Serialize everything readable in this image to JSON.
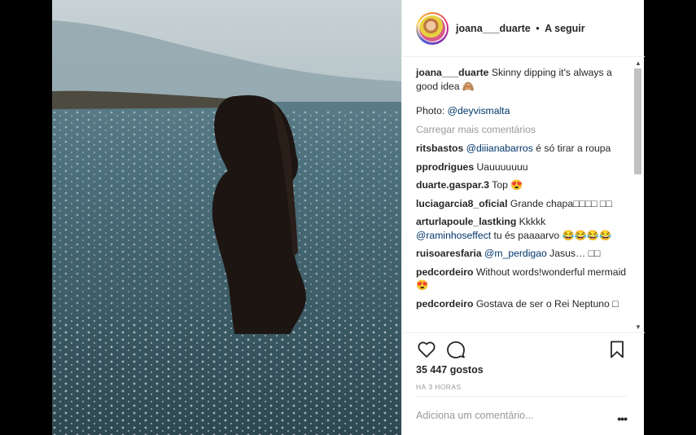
{
  "post": {
    "username": "joana___duarte",
    "separator": "•",
    "follow_label": "A seguir",
    "caption_user": "joana___duarte",
    "caption_text": "Skinny dipping it's always a good idea 🙈",
    "photo_credit_prefix": "Photo: ",
    "photo_credit_mention": "@deyvismalta",
    "load_more": "Carregar mais comentários"
  },
  "comments": [
    {
      "user": "ritsbastos",
      "mention": "@diiianabarros",
      "text": " é só tirar a roupa"
    },
    {
      "user": "pprodrigues",
      "mention": "",
      "text": "Uauuuuuuu"
    },
    {
      "user": "duarte.gaspar.3",
      "mention": "",
      "text": "Top 😍"
    },
    {
      "user": "luciagarcia8_oficial",
      "mention": "",
      "text": "Grande chapa□□□□ □□"
    },
    {
      "user": "arturlapoule_lastking",
      "mention": "",
      "text": "Kkkkk"
    },
    {
      "user": "",
      "mention": "@raminhoseffect",
      "text": " tu és paaaarvo 😂😂😂😂"
    },
    {
      "user": "ruisoaresfaria",
      "mention": "@m_perdigao",
      "text": " Jasus… □□"
    },
    {
      "user": "pedcordeiro",
      "mention": "",
      "text": "Without words!wonderful mermaid😍"
    },
    {
      "user": "pedcordeiro",
      "mention": "",
      "text": "Gostava de ser o Rei Neptuno □"
    }
  ],
  "stats": {
    "likes": "35 447 gostos",
    "time": "HÁ 3 HORAS"
  },
  "add_comment": {
    "placeholder": "Adiciona um comentário...",
    "more_label": "•••"
  },
  "icons": {
    "like": "heart-icon",
    "comment": "comment-icon",
    "save": "bookmark-icon",
    "more": "more-options-icon"
  },
  "colors": {
    "mention": "#003569",
    "muted": "#999999",
    "text": "#262626",
    "backdrop": "#000000"
  }
}
